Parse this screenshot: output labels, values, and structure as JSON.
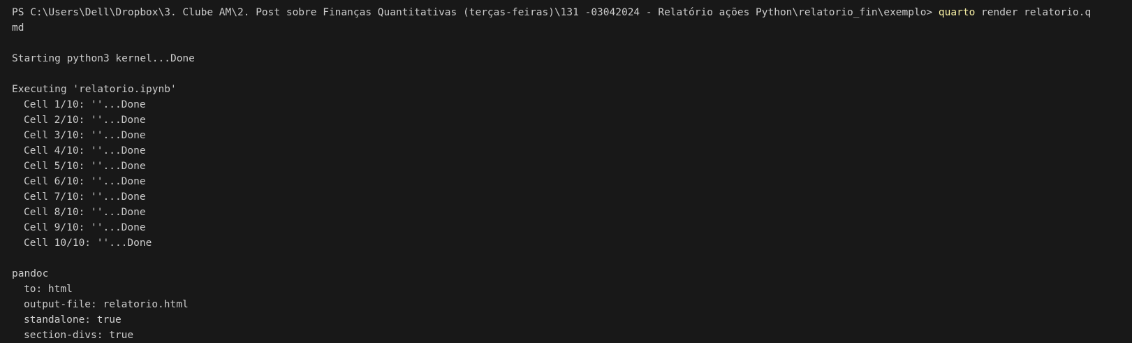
{
  "prompt": {
    "prefix": "PS C:\\Users\\Dell\\Dropbox\\3. Clube AM\\2. Post sobre Finanças Quantitativas (terças-feiras)\\131 -03042024 - Relatório ações Python\\relatorio_fin\\exemplo> ",
    "command": "quarto",
    "args": " render relatorio.q",
    "wrap": "md"
  },
  "kernel_line": "Starting python3 kernel...Done",
  "executing_line": "Executing 'relatorio.ipynb'",
  "cells": [
    "Cell 1/10: ''...Done",
    "Cell 2/10: ''...Done",
    "Cell 3/10: ''...Done",
    "Cell 4/10: ''...Done",
    "Cell 5/10: ''...Done",
    "Cell 6/10: ''...Done",
    "Cell 7/10: ''...Done",
    "Cell 8/10: ''...Done",
    "Cell 9/10: ''...Done",
    "Cell 10/10: ''...Done"
  ],
  "pandoc": {
    "header": "pandoc",
    "options": [
      "to: html",
      "output-file: relatorio.html",
      "standalone: true",
      "section-divs: true"
    ]
  },
  "colors": {
    "background": "#181818",
    "text": "#cccccc",
    "command": "#f9f1a5"
  }
}
